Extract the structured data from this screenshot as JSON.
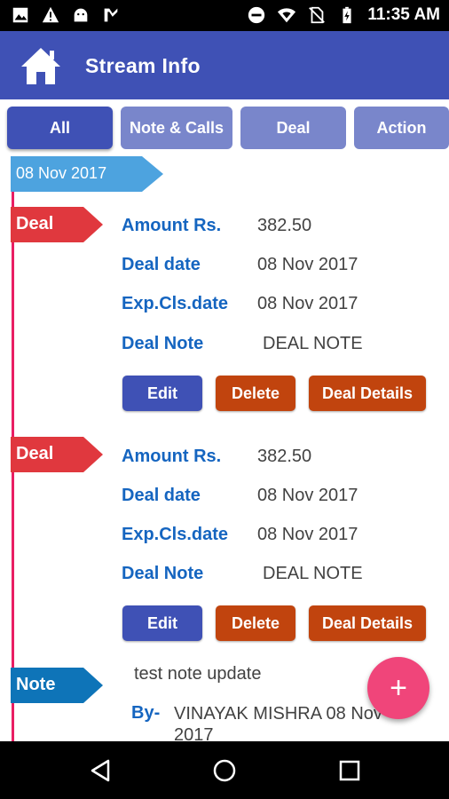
{
  "status_bar": {
    "time": "11:35 AM",
    "left_icons": [
      "image-icon",
      "warning-icon",
      "android-icon",
      "download-icon"
    ],
    "right_icons": [
      "do-not-disturb-icon",
      "wifi-icon",
      "no-sim-icon",
      "battery-icon"
    ]
  },
  "app_bar": {
    "title": "Stream Info",
    "icon": "home-icon",
    "color": "#3f51b5"
  },
  "tabs": [
    {
      "label": "All",
      "active": true
    },
    {
      "label": "Note & Calls",
      "active": false
    },
    {
      "label": "Deal",
      "active": false
    },
    {
      "label": "Action",
      "active": false
    }
  ],
  "timeline": {
    "date": "08 Nov 2017",
    "line_color": "#e91e63",
    "items": [
      {
        "tag": "Deal",
        "fields": [
          {
            "label": "Amount Rs.",
            "value": "382.50"
          },
          {
            "label": "Deal date",
            "value": "08 Nov 2017"
          },
          {
            "label": "Exp.Cls.date",
            "value": "08 Nov 2017"
          },
          {
            "label": "Deal Note",
            "value": "DEAL NOTE"
          }
        ],
        "buttons": {
          "edit": "Edit",
          "delete": "Delete",
          "details": "Deal Details"
        }
      },
      {
        "tag": "Deal",
        "fields": [
          {
            "label": "Amount Rs.",
            "value": "382.50"
          },
          {
            "label": "Deal date",
            "value": "08 Nov 2017"
          },
          {
            "label": "Exp.Cls.date",
            "value": "08 Nov 2017"
          },
          {
            "label": "Deal Note",
            "value": "DEAL NOTE"
          }
        ],
        "buttons": {
          "edit": "Edit",
          "delete": "Delete",
          "details": "Deal Details"
        }
      },
      {
        "tag": "Note",
        "text": "test note update",
        "by_label": "By-",
        "by_value": "VINAYAK MISHRA 08 Nov 2017"
      }
    ]
  },
  "fab": {
    "symbol": "+",
    "color": "#f0457a"
  },
  "nav_bar": {
    "icons": [
      "back-icon",
      "home-circle-icon",
      "recents-icon"
    ]
  }
}
